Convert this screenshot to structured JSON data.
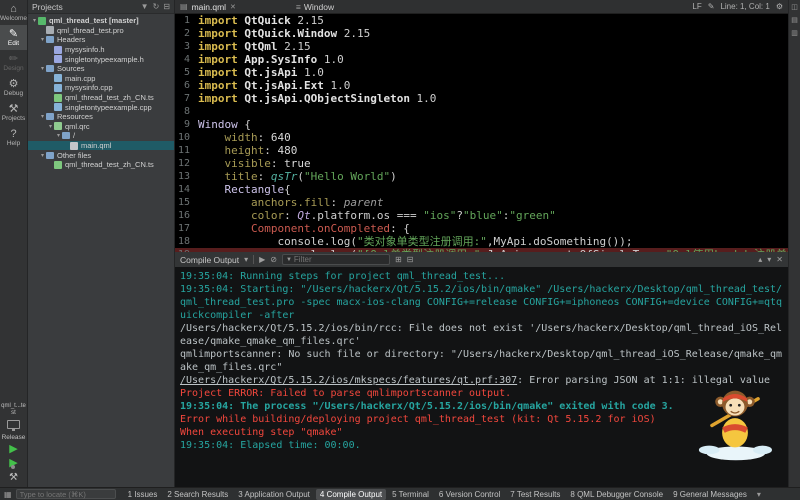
{
  "activity_bar": {
    "items": [
      {
        "id": "welcome",
        "label": "Welcome",
        "active": false,
        "disabled": false
      },
      {
        "id": "edit",
        "label": "Edit",
        "active": true,
        "disabled": false
      },
      {
        "id": "design",
        "label": "Design",
        "active": false,
        "disabled": true
      },
      {
        "id": "debug",
        "label": "Debug",
        "active": false,
        "disabled": false
      },
      {
        "id": "projects",
        "label": "Projects",
        "active": false,
        "disabled": false
      },
      {
        "id": "help",
        "label": "Help",
        "active": false,
        "disabled": false
      }
    ],
    "kit_project": "qml_t...test",
    "build_config": "Release"
  },
  "projects_pane": {
    "title": "Projects",
    "tree": [
      {
        "label": "qml_thread_test [master]",
        "depth": 0,
        "expanded": true,
        "icon": "project",
        "bold": true
      },
      {
        "label": "qml_thread_test.pro",
        "depth": 1,
        "icon": "pro"
      },
      {
        "label": "Headers",
        "depth": 1,
        "expanded": true,
        "icon": "folder"
      },
      {
        "label": "mysysinfo.h",
        "depth": 2,
        "icon": "h"
      },
      {
        "label": "singletontypeexample.h",
        "depth": 2,
        "icon": "h"
      },
      {
        "label": "Sources",
        "depth": 1,
        "expanded": true,
        "icon": "folder"
      },
      {
        "label": "main.cpp",
        "depth": 2,
        "icon": "cpp"
      },
      {
        "label": "mysysinfo.cpp",
        "depth": 2,
        "icon": "cpp"
      },
      {
        "label": "qml_thread_test_zh_CN.ts",
        "depth": 2,
        "icon": "ts"
      },
      {
        "label": "singletontypeexample.cpp",
        "depth": 2,
        "icon": "cpp"
      },
      {
        "label": "Resources",
        "depth": 1,
        "expanded": true,
        "icon": "folder"
      },
      {
        "label": "qml.qrc",
        "depth": 2,
        "expanded": true,
        "icon": "qrc"
      },
      {
        "label": "/",
        "depth": 3,
        "expanded": true,
        "icon": "folder"
      },
      {
        "label": "main.qml",
        "depth": 4,
        "icon": "qml",
        "selected": true
      },
      {
        "label": "Other files",
        "depth": 1,
        "expanded": true,
        "icon": "folder"
      },
      {
        "label": "qml_thread_test_zh_CN.ts",
        "depth": 2,
        "icon": "ts"
      }
    ]
  },
  "editor": {
    "tab": "main.qml",
    "context_selector": "Window",
    "line_ending": "LF",
    "cursor_position": "Line: 1, Col: 1",
    "lines": [
      {
        "n": 1,
        "segs": [
          [
            "kw",
            "import"
          ],
          [
            "mod",
            " QtQuick"
          ],
          [
            "ver",
            " 2.15"
          ]
        ]
      },
      {
        "n": 2,
        "segs": [
          [
            "kw",
            "import"
          ],
          [
            "mod",
            " QtQuick.Window"
          ],
          [
            "ver",
            " 2.15"
          ]
        ]
      },
      {
        "n": 3,
        "segs": [
          [
            "kw",
            "import"
          ],
          [
            "mod",
            " QtQml"
          ],
          [
            "ver",
            " 2.15"
          ]
        ]
      },
      {
        "n": 4,
        "segs": [
          [
            "kw",
            "import"
          ],
          [
            "mod",
            " App.SysInfo"
          ],
          [
            "ver",
            " 1.0"
          ]
        ]
      },
      {
        "n": 5,
        "segs": [
          [
            "kw",
            "import"
          ],
          [
            "mod",
            " Qt.jsApi"
          ],
          [
            "ver",
            " 1.0"
          ]
        ]
      },
      {
        "n": 6,
        "segs": [
          [
            "kw",
            "import"
          ],
          [
            "mod",
            " Qt.jsApi.Ext"
          ],
          [
            "ver",
            " 1.0"
          ]
        ]
      },
      {
        "n": 7,
        "segs": [
          [
            "kw",
            "import"
          ],
          [
            "mod",
            " Qt.jsApi.QObjectSingleton"
          ],
          [
            "ver",
            " 1.0"
          ]
        ]
      },
      {
        "n": 8,
        "segs": []
      },
      {
        "n": 9,
        "segs": [
          [
            "typ",
            "Window"
          ],
          [
            "plain",
            " {"
          ]
        ]
      },
      {
        "n": 10,
        "segs": [
          [
            "plain",
            "    "
          ],
          [
            "prop",
            "width"
          ],
          [
            "plain",
            ": "
          ],
          [
            "num",
            "640"
          ]
        ]
      },
      {
        "n": 11,
        "segs": [
          [
            "plain",
            "    "
          ],
          [
            "prop",
            "height"
          ],
          [
            "plain",
            ": "
          ],
          [
            "num",
            "480"
          ]
        ]
      },
      {
        "n": 12,
        "segs": [
          [
            "plain",
            "    "
          ],
          [
            "prop",
            "visible"
          ],
          [
            "plain",
            ": "
          ],
          [
            "kwv",
            "true"
          ]
        ]
      },
      {
        "n": 13,
        "segs": [
          [
            "plain",
            "    "
          ],
          [
            "prop",
            "title"
          ],
          [
            "plain",
            ": "
          ],
          [
            "fn",
            "qsTr"
          ],
          [
            "plain",
            "("
          ],
          [
            "str",
            "\"Hello World\""
          ],
          [
            "plain",
            ")"
          ]
        ]
      },
      {
        "n": 14,
        "segs": [
          [
            "plain",
            "    "
          ],
          [
            "typ",
            "Rectangle"
          ],
          [
            "plain",
            "{"
          ]
        ]
      },
      {
        "n": 15,
        "segs": [
          [
            "plain",
            "        "
          ],
          [
            "prop",
            "anchors.fill"
          ],
          [
            "plain",
            ": "
          ],
          [
            "pv",
            "parent"
          ]
        ]
      },
      {
        "n": 16,
        "segs": [
          [
            "plain",
            "        "
          ],
          [
            "prop",
            "color"
          ],
          [
            "plain",
            ": "
          ],
          [
            "qt",
            "Qt"
          ],
          [
            "plain",
            ".platform.os === "
          ],
          [
            "str",
            "\"ios\""
          ],
          [
            "plain",
            "?"
          ],
          [
            "str",
            "\"blue\""
          ],
          [
            "plain",
            ":"
          ],
          [
            "str",
            "\"green\""
          ]
        ]
      },
      {
        "n": 17,
        "segs": [
          [
            "plain",
            "        "
          ],
          [
            "sig",
            "Component.onCompleted"
          ],
          [
            "plain",
            ": {"
          ]
        ]
      },
      {
        "n": 18,
        "segs": [
          [
            "plain",
            "            "
          ],
          [
            "plain",
            "console.log("
          ],
          [
            "str",
            "\"类对象单类型注册调用:\""
          ],
          [
            "plain",
            ","
          ],
          [
            "plain",
            "MyApi"
          ],
          [
            "plain",
            ".doSomething());"
          ]
        ]
      },
      {
        "n": 19,
        "err": true,
        "segs": [
          [
            "plain",
            "            "
          ],
          [
            "plain",
            "console.log("
          ],
          [
            "str",
            "\"[Qml单类型注册调用:\""
          ],
          [
            "plain",
            ","
          ],
          [
            "plain",
            "JsApi.propertyOfSingleType,"
          ],
          [
            "str",
            "\"Qml使用Lambda注册单类型调用:\""
          ],
          [
            "plain",
            ","
          ],
          [
            "plain",
            "JsApi."
          ]
        ]
      }
    ]
  },
  "output_panel": {
    "title": "Compile Output",
    "filter_placeholder": "Filter",
    "mascot": "monkey-king-mascot",
    "lines": [
      {
        "c": "teal",
        "t": "19:35:04: Running steps for project qml_thread_test..."
      },
      {
        "c": "teal",
        "t": "19:35:04: Starting: \"/Users/hackerx/Qt/5.15.2/ios/bin/qmake\" /Users/hackerx/Desktop/qml_thread_test/qml_thread_test.pro -spec macx-ios-clang CONFIG+=release CONFIG+=iphoneos CONFIG+=device CONFIG+=qtquickcompiler -after"
      },
      {
        "c": "gray",
        "t": "/Users/hackerx/Qt/5.15.2/ios/bin/rcc: File does not exist '/Users/hackerx/Desktop/qml_thread_iOS_Release/qmake_qmake_qm_files.qrc'"
      },
      {
        "c": "gray",
        "t": "qmlimportscanner: No such file or directory: \"/Users/hackerx/Desktop/qml_thread_iOS_Release/qmake_qmake_qm_files.qrc\""
      },
      {
        "c": "gray",
        "link": "/Users/hackerx/Qt/5.15.2/ios/mkspecs/features/qt.prf:307",
        "t": ": Error parsing JSON at 1:1: illegal value"
      },
      {
        "c": "red",
        "t": "Project ERROR: Failed to parse qmlimportscanner output."
      },
      {
        "c": "teal",
        "bold": true,
        "t": "19:35:04: The process \"/Users/hackerx/Qt/5.15.2/ios/bin/qmake\" exited with code 3."
      },
      {
        "c": "red",
        "t": "Error while building/deploying project qml_thread_test (kit: Qt 5.15.2 for iOS)"
      },
      {
        "c": "red",
        "t": "When executing step \"qmake\""
      },
      {
        "c": "teal",
        "t": "19:35:04: Elapsed time: 00:00."
      }
    ]
  },
  "status_bar": {
    "locator_placeholder": "Type to locate (⌘K)",
    "panes": [
      "1 Issues",
      "2 Search Results",
      "3 Application Output",
      "4 Compile Output",
      "5 Terminal",
      "6 Version Control",
      "7 Test Results",
      "8 QML Debugger Console",
      "9 General Messages"
    ],
    "active_index": 3
  }
}
